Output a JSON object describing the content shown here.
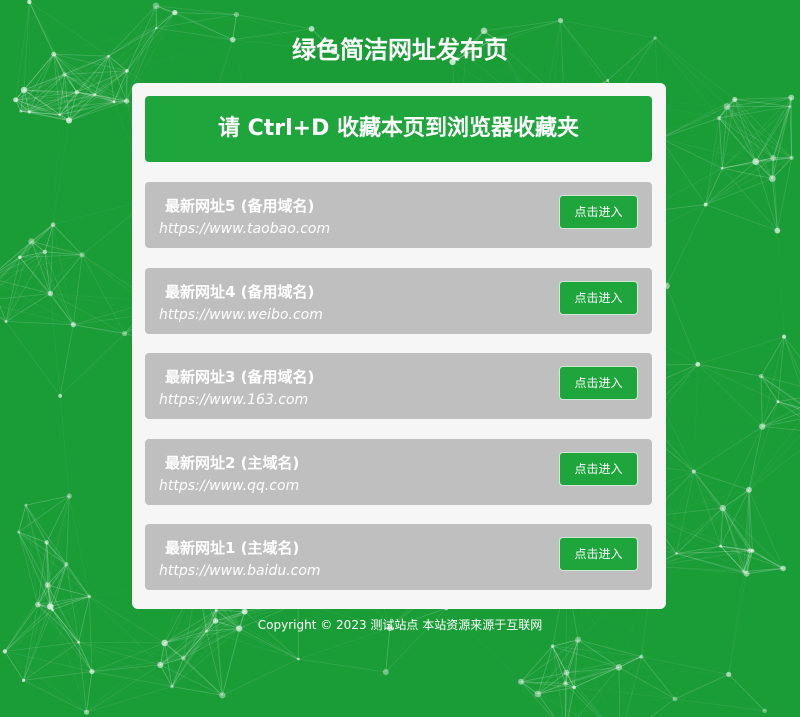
{
  "header": {
    "title": "绿色简洁网址发布页"
  },
  "banner": {
    "text": "请 Ctrl+D 收藏本页到浏览器收藏夹"
  },
  "links": [
    {
      "name": "最新网址5 (备用域名)",
      "url": "https://www.taobao.com",
      "button": "点击进入"
    },
    {
      "name": "最新网址4 (备用域名)",
      "url": "https://www.weibo.com",
      "button": "点击进入"
    },
    {
      "name": "最新网址3 (备用域名)",
      "url": "https://www.163.com",
      "button": "点击进入"
    },
    {
      "name": "最新网址2 (主域名)",
      "url": "https://www.qq.com",
      "button": "点击进入"
    },
    {
      "name": "最新网址1 (主域名)",
      "url": "https://www.baidu.com",
      "button": "点击进入"
    }
  ],
  "footer": {
    "text": "Copyright © 2023 测试站点 本站资源来源于互联网"
  },
  "colors": {
    "background": "#1a9c37",
    "accent": "#1ea53b",
    "row": "#bfbfbf",
    "card": "#f6f6f6"
  }
}
